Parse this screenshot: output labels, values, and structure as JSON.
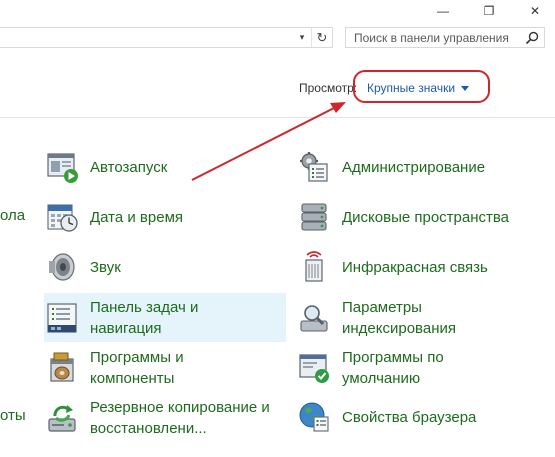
{
  "window": {
    "min_glyph": "—",
    "max_glyph": "❐",
    "close_glyph": "✕"
  },
  "address": {
    "dropdown_glyph": "▾",
    "refresh_glyph": "↻"
  },
  "search": {
    "placeholder": "Поиск в панели управления",
    "icon": "search-icon"
  },
  "view": {
    "label": "Просмотр:",
    "selected": "Крупные значки"
  },
  "annotation_color": "#d0252b",
  "left_column": [
    {
      "label_lines": [
        "Автозапуск"
      ],
      "icon": "autoplay-icon"
    },
    {
      "label_lines": [
        "Дата и время"
      ],
      "icon": "date-time-icon"
    },
    {
      "label_lines": [
        "Звук"
      ],
      "icon": "speaker-icon"
    },
    {
      "label_lines": [
        "Панель задач и",
        "навигация"
      ],
      "icon": "taskbar-icon",
      "selected": true
    },
    {
      "label_lines": [
        "Программы и",
        "компоненты"
      ],
      "icon": "programs-icon"
    },
    {
      "label_lines": [
        "Резервное копирование и",
        "восстановлени..."
      ],
      "icon": "backup-icon"
    }
  ],
  "right_column": [
    {
      "label_lines": [
        "Администрирование"
      ],
      "icon": "admin-tools-icon"
    },
    {
      "label_lines": [
        "Дисковые пространства"
      ],
      "icon": "storage-spaces-icon"
    },
    {
      "label_lines": [
        "Инфракрасная связь"
      ],
      "icon": "infrared-icon"
    },
    {
      "label_lines": [
        "Параметры",
        "индексирования"
      ],
      "icon": "indexing-icon"
    },
    {
      "label_lines": [
        "Программы по",
        "умолчанию"
      ],
      "icon": "default-programs-icon"
    },
    {
      "label_lines": [
        "Свойства браузера"
      ],
      "icon": "internet-options-icon"
    }
  ],
  "cut_off_labels": [
    "ола",
    "оты"
  ]
}
